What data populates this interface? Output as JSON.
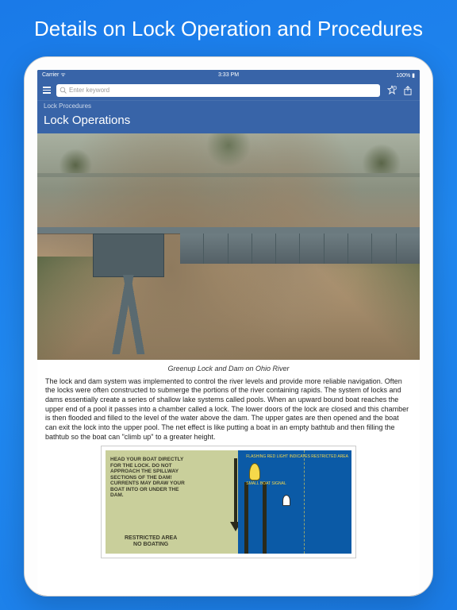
{
  "headline": "Details on Lock Operation and Procedures",
  "statusbar": {
    "left": "Carrier ᯤ",
    "time": "3:33 PM",
    "right": "100% ▮"
  },
  "navbar": {
    "search_placeholder": "Enter keyword",
    "breadcrumb": "Lock Procedures",
    "page_title": "Lock Operations"
  },
  "caption": "Greenup Lock and Dam on Ohio River",
  "body_text": "The lock and dam system was implemented to control the river levels and provide more reliable navigation. Often the locks were often constructed to submerge the portions of the river containing rapids. The system of locks and dams essentially create a series of shallow lake systems called pools. When an upward bound boat reaches the upper end of a pool it passes into a chamber called a lock. The lower doors of the lock are closed and this chamber is then flooded and filled to the level of the water above the dam. The upper gates are then opened and the boat can exit the lock into the upper pool. The net effect is like putting a boat in an empty bathtub and then filling the bathtub so the boat can \"climb up\" to a greater height.",
  "diagram": {
    "warning": "HEAD YOUR BOAT DIRECTLY FOR THE LOCK. DO NOT APPROACH THE SPILLWAY SECTIONS OF THE DAM! CURRENTS MAY DRAW YOUR BOAT INTO OR UNDER THE DAM.",
    "restricted": "RESTRICTED AREA\nNO BOATING",
    "label1": "FLASHING RED LIGHT INDICATES RESTRICTED AREA",
    "label2": "SMALL BOAT SIGNAL"
  }
}
